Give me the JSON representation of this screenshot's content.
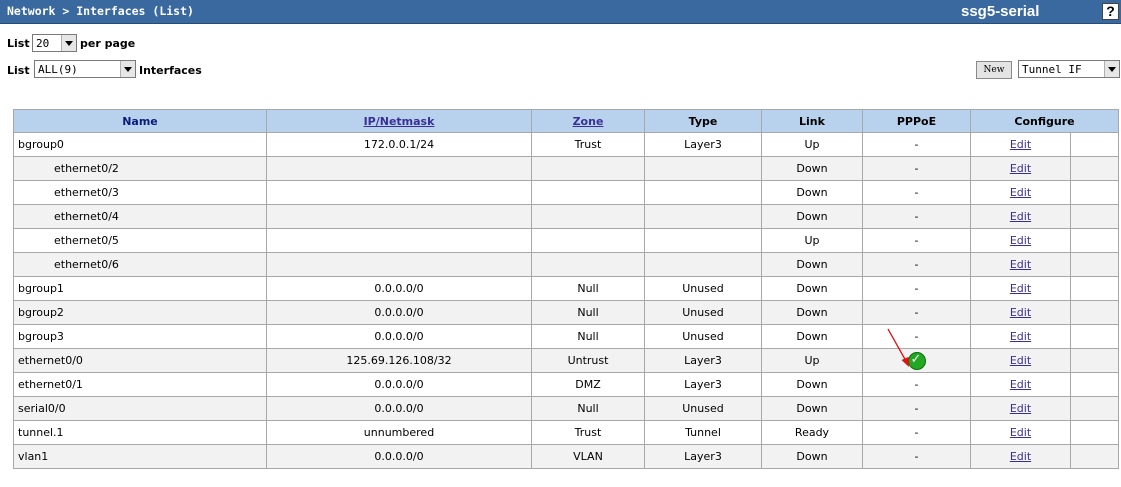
{
  "header": {
    "breadcrumb": "Network > Interfaces (List)",
    "device_name": "ssg5-serial",
    "help_label": "?"
  },
  "controls": {
    "list_label_1": "List",
    "per_page_value": "20",
    "per_page_label": "per page",
    "list_label_2": "List",
    "filter_value": "ALL(9)",
    "interfaces_label": "Interfaces",
    "new_button": "New",
    "type_value": "Tunnel IF"
  },
  "table": {
    "columns": [
      "Name",
      "IP/Netmask",
      "Zone",
      "Type",
      "Link",
      "PPPoE",
      "Configure"
    ],
    "rows": [
      {
        "name": "bgroup0",
        "ip": "172.0.0.1/24",
        "zone": "Trust",
        "type": "Layer3",
        "link": "Up",
        "pppoe": "-",
        "configure": "Edit"
      },
      {
        "name": "ethernet0/2",
        "ip": "",
        "zone": "",
        "type": "",
        "link": "Down",
        "pppoe": "-",
        "configure": "Edit"
      },
      {
        "name": "ethernet0/3",
        "ip": "",
        "zone": "",
        "type": "",
        "link": "Down",
        "pppoe": "-",
        "configure": "Edit"
      },
      {
        "name": "ethernet0/4",
        "ip": "",
        "zone": "",
        "type": "",
        "link": "Down",
        "pppoe": "-",
        "configure": "Edit"
      },
      {
        "name": "ethernet0/5",
        "ip": "",
        "zone": "",
        "type": "",
        "link": "Up",
        "pppoe": "-",
        "configure": "Edit"
      },
      {
        "name": "ethernet0/6",
        "ip": "",
        "zone": "",
        "type": "",
        "link": "Down",
        "pppoe": "-",
        "configure": "Edit"
      },
      {
        "name": "bgroup1",
        "ip": "0.0.0.0/0",
        "zone": "Null",
        "type": "Unused",
        "link": "Down",
        "pppoe": "-",
        "configure": "Edit"
      },
      {
        "name": "bgroup2",
        "ip": "0.0.0.0/0",
        "zone": "Null",
        "type": "Unused",
        "link": "Down",
        "pppoe": "-",
        "configure": "Edit"
      },
      {
        "name": "bgroup3",
        "ip": "0.0.0.0/0",
        "zone": "Null",
        "type": "Unused",
        "link": "Down",
        "pppoe": "-",
        "configure": "Edit"
      },
      {
        "name": "ethernet0/0",
        "ip": "125.69.126.108/32",
        "zone": "Untrust",
        "type": "Layer3",
        "link": "Up",
        "pppoe": "",
        "configure": "Edit"
      },
      {
        "name": "ethernet0/1",
        "ip": "0.0.0.0/0",
        "zone": "DMZ",
        "type": "Layer3",
        "link": "Down",
        "pppoe": "-",
        "configure": "Edit"
      },
      {
        "name": "serial0/0",
        "ip": "0.0.0.0/0",
        "zone": "Null",
        "type": "Unused",
        "link": "Down",
        "pppoe": "-",
        "configure": "Edit"
      },
      {
        "name": "tunnel.1",
        "ip": "unnumbered",
        "zone": "Trust",
        "type": "Tunnel",
        "link": "Ready",
        "pppoe": "-",
        "configure": "Edit"
      },
      {
        "name": "vlan1",
        "ip": "0.0.0.0/0",
        "zone": "VLAN",
        "type": "Layer3",
        "link": "Down",
        "pppoe": "-",
        "configure": "Edit"
      }
    ]
  },
  "icons": {
    "pppoe_ok": "checkmark-icon",
    "annotation": "red-arrow-icon"
  },
  "colors": {
    "header_bar": "#3a69a0",
    "table_header": "#b8d2ee",
    "link": "#3a2f96",
    "check_green": "#22a822",
    "arrow_red": "#e01010"
  }
}
